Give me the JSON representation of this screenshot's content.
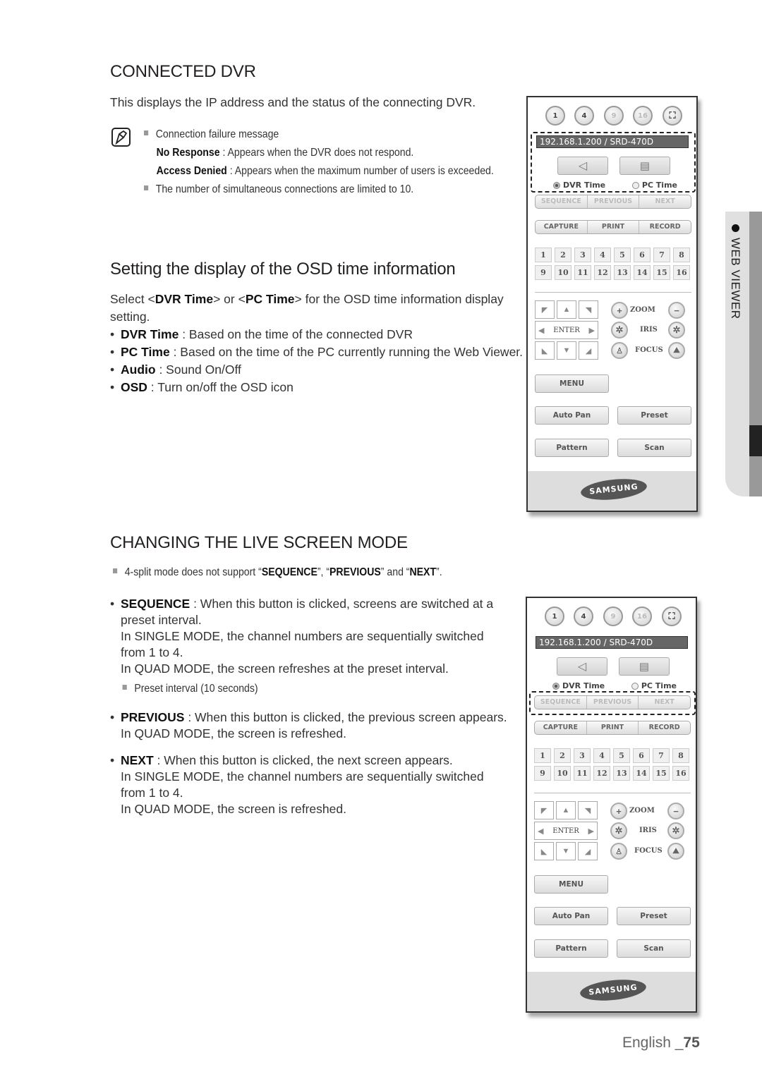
{
  "section1": {
    "title": "CONNECTED DVR",
    "intro": "This displays the IP address and the status of the connecting DVR.",
    "notes": {
      "item1": "Connection failure message",
      "no_response_label": "No Response",
      "no_response_text": " : Appears when the DVR does not respond.",
      "access_denied_label": "Access Denied",
      "access_denied_text": " : Appears when the maximum number of users is exceeded.",
      "item2": "The number of simultaneous connections are limited to 10."
    }
  },
  "section2": {
    "title": "Setting the display of the OSD time information",
    "intro_a": "Select <",
    "intro_dvr": "DVR Time",
    "intro_b": "> or <",
    "intro_pc": "PC Time",
    "intro_c": "> for the OSD time information display setting.",
    "bullets": [
      {
        "label": "DVR Time",
        "text": " : Based on the time of the connected DVR"
      },
      {
        "label": "PC Time",
        "text": " : Based on the time of the PC currently running the Web Viewer."
      },
      {
        "label": "Audio",
        "text": " : Sound On/Off"
      },
      {
        "label": "OSD",
        "text": " : Turn on/off the OSD icon"
      }
    ]
  },
  "section3": {
    "title": "CHANGING THE LIVE SCREEN MODE",
    "note_a": "4-split mode does not support “",
    "note_seq": "SEQUENCE",
    "note_b": "”, “",
    "note_prev": "PREVIOUS",
    "note_c": "” and “",
    "note_next": "NEXT",
    "note_d": "”.",
    "sequence": {
      "label": "SEQUENCE",
      "line1": " : When this button is clicked, screens are switched at a preset interval.",
      "line2": "In SINGLE MODE, the channel numbers are sequentially switched from 1 to 4.",
      "line3": "In QUAD MODE, the screen refreshes at the preset interval.",
      "subnote": "Preset interval (10 seconds)"
    },
    "previous": {
      "label": "PREVIOUS",
      "line1": " : When this button is clicked, the previous screen appears.",
      "line2": "In QUAD MODE, the screen is refreshed."
    },
    "next": {
      "label": "NEXT",
      "line1": " : When this button is clicked, the next screen appears.",
      "line2": "In SINGLE MODE, the channel numbers are sequentially switched from 1 to 4.",
      "line3": "In QUAD MODE, the screen is refreshed."
    }
  },
  "viewer": {
    "split_buttons": [
      "1",
      "4",
      "9",
      "16"
    ],
    "fullscreen_icon": "fullscreen-icon",
    "ip_text": "192.168.1.200   / SRD-470D",
    "audio_icon": "speaker-icon",
    "osd_icon": "monitor-icon",
    "dvr_time": "DVR Time",
    "pc_time": "PC Time",
    "selected_time": "DVR Time",
    "seq_buttons": [
      "SEQUENCE",
      "PREVIOUS",
      "NEXT"
    ],
    "action_buttons": [
      "CAPTURE",
      "PRINT",
      "RECORD"
    ],
    "channels": [
      "1",
      "2",
      "3",
      "4",
      "5",
      "6",
      "7",
      "8",
      "9",
      "10",
      "11",
      "12",
      "13",
      "14",
      "15",
      "16"
    ],
    "enter": "ENTER",
    "zoom": "ZOOM",
    "iris": "IRIS",
    "focus": "FOCUS",
    "menu": "MENU",
    "auto_pan": "Auto Pan",
    "preset": "Preset",
    "pattern": "Pattern",
    "scan": "Scan",
    "logo": "SAMSUNG"
  },
  "side_tab": {
    "label": "WEB VIEWER"
  },
  "footer": {
    "language": "English _",
    "page": "75"
  }
}
